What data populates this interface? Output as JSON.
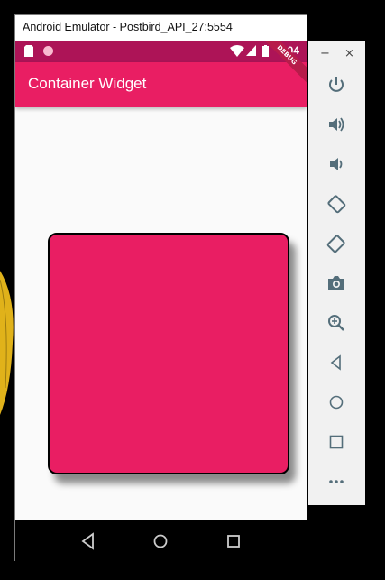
{
  "window": {
    "title": "Android Emulator - Postbird_API_27:5554",
    "minimize_glyph": "−",
    "close_glyph": "×"
  },
  "status_bar": {
    "time": "3:04",
    "icons": [
      "sd-card-icon",
      "circle-notification-icon",
      "wifi-icon",
      "signal-icon",
      "battery-icon"
    ]
  },
  "app_bar": {
    "title": "Container Widget",
    "debug_banner": "DEBUG"
  },
  "container": {
    "color": "#e91e63",
    "border_color": "#000000"
  },
  "nav_bar": {
    "buttons": [
      "back-icon",
      "home-icon",
      "recents-icon"
    ]
  },
  "side_panel": {
    "buttons": [
      "power-icon",
      "volume-up-icon",
      "volume-down-icon",
      "rotate-left-icon",
      "rotate-right-icon",
      "camera-icon",
      "zoom-icon",
      "back-icon",
      "home-icon",
      "overview-icon",
      "more-icon"
    ]
  },
  "colors": {
    "accent": "#e91e63",
    "status_bar": "#ad1457",
    "background": "#fafafa"
  }
}
